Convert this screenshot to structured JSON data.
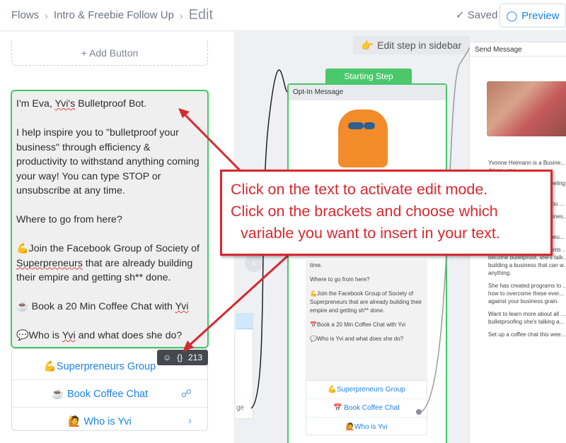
{
  "header": {
    "crumb1": "Flows",
    "crumb2": "Intro & Freebie Follow Up",
    "crumb3": "Edit",
    "saved": "Saved",
    "preview": "Preview"
  },
  "editor": {
    "add_button": "+ Add Button",
    "text_lines": [
      "I'm Eva, Yvi's Bulletproof Bot.",
      "I help inspire you to \"bulletproof your business\" through efficiency & productivity to withstand anything coming your way! You can type STOP or unsubscribe at any time.",
      "Where to go from here?",
      "💪Join the Facebook Group of Society of Superpreneurs that are already building their empire and getting sh** done.",
      "☕ Book a 20 Min Coffee Chat with Yvi",
      "💬Who is Yvi and what does she do?"
    ],
    "char_count": "213",
    "buttons": [
      {
        "label": "💪Superpreneurs Group"
      },
      {
        "label": "☕ Book Coffee Chat"
      },
      {
        "label": "🙋 Who is Yvi"
      }
    ]
  },
  "canvas": {
    "hint": "Edit step in sidebar",
    "starting_step": "Starting Step",
    "optin_title": "Opt-In Message",
    "optin_text": [
      "time.",
      "Where to go from here?",
      "💪Join the Facebook Group of Society of Superpreneurs that are already building their empire and getting sh** done.",
      "📅Book a 20 Min Coffee Chat with Yvi",
      "💬Who is Yvi and what does she do?"
    ],
    "optin_buttons": [
      "💪Superpreneurs Group",
      "📅 Book Coffee Chat",
      "🙋Who is Yvi"
    ],
    "left_node_fragment": "ge",
    "send_message_title": "Send Message",
    "send_text": [
      "Yvonne Heimann is a Busine... driver... mo",
      "💪 Take vacations (and feeling ... about it)",
      "💪Take sick days when you ...",
      "💪Working FOR your busines... versa",
      "(Sound familiar, entrepreneu...",
      "When Yvi teaches her clients ... become bulletproof, she's talk... building a business that can w... anything.",
      "She has created programs to ... how to overcome these ever... against your business grain.",
      "Want to learn more about all ... bulletproofing she's talking a...",
      "Set up a coffee chat this wee..."
    ]
  },
  "annotation": {
    "line1": "Click on the text to activate edit mode.",
    "line2": "Click on the brackets and choose which",
    "line3": "variable you want to insert in your text."
  },
  "colors": {
    "accent": "#1b84e7",
    "green": "#45c66a",
    "annotation_red": "#d7282f"
  }
}
